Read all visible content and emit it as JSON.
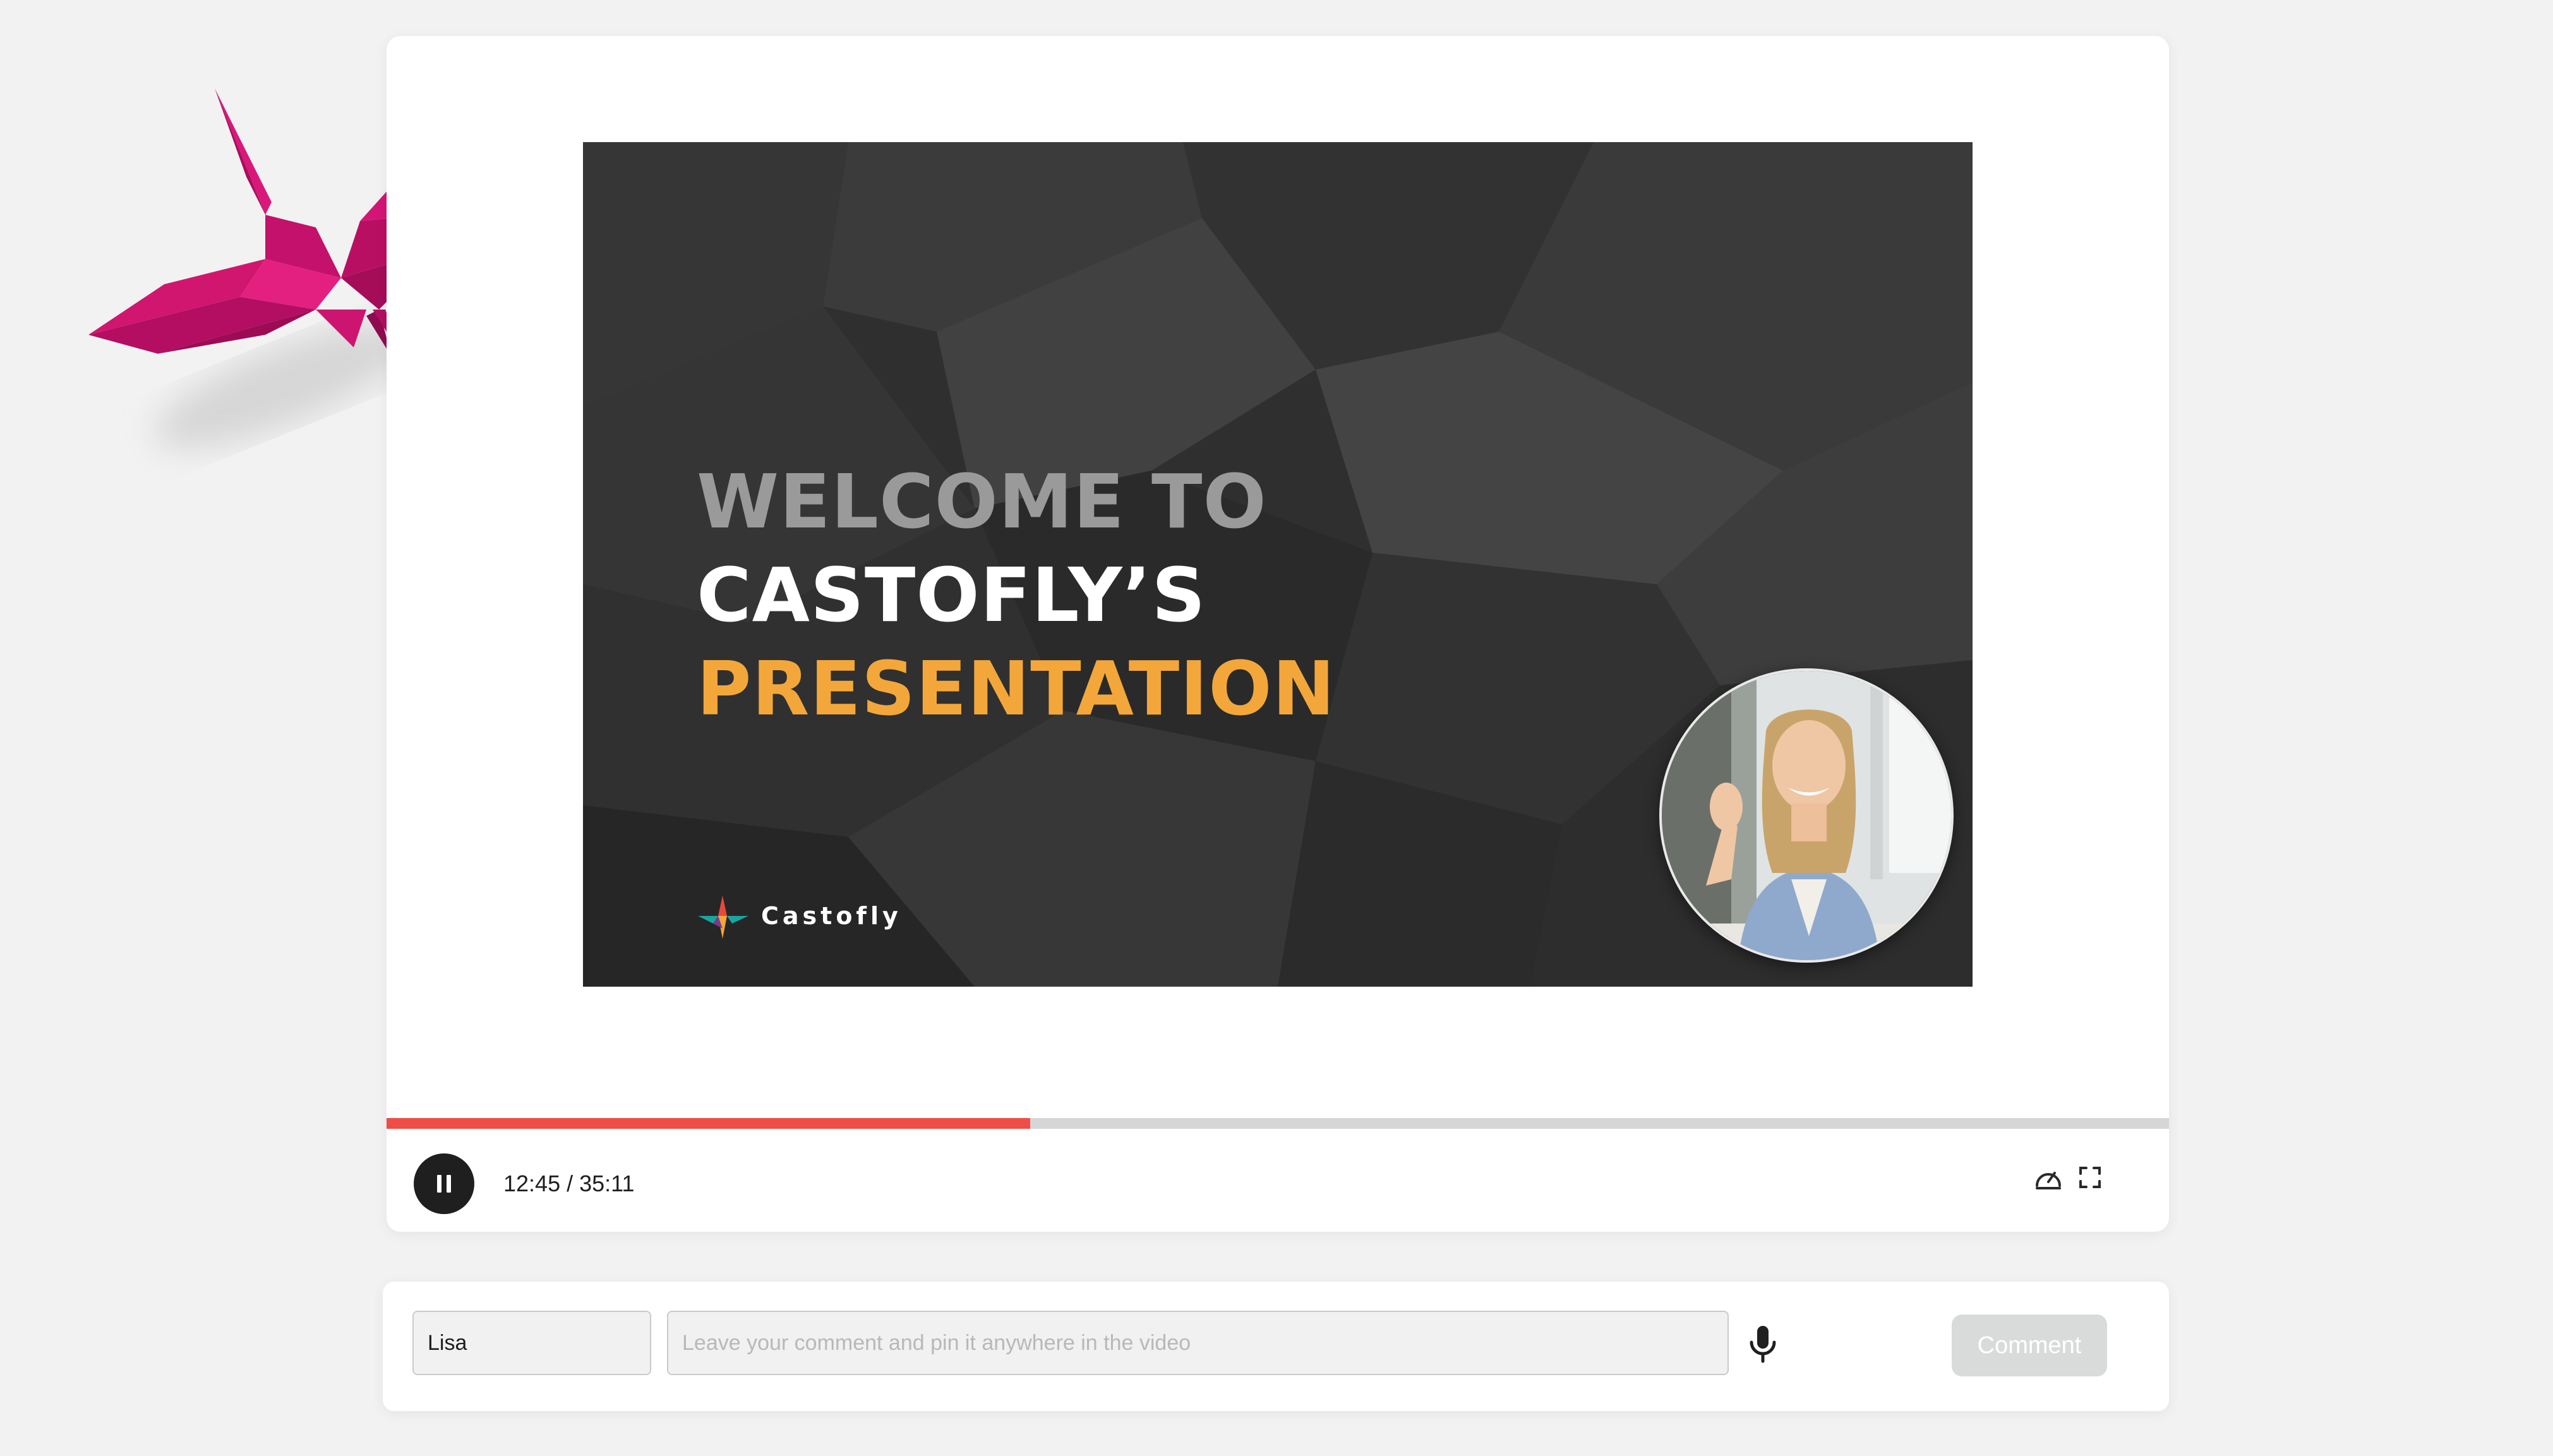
{
  "slide": {
    "title_line1": "WELCOME TO",
    "title_line2": "CASTOFLY’S",
    "title_line3": "PRESENTATION",
    "brand_name": "Castofly"
  },
  "player": {
    "progress_fraction": 0.361,
    "current_time": "12:45",
    "separator": " / ",
    "total_time": "35:11",
    "play_state": "pause-icon",
    "right_icons": [
      "speed-icon",
      "fullscreen-icon"
    ]
  },
  "comment": {
    "name_value": "Lisa",
    "comment_placeholder": "Leave your comment and pin it anywhere in the video",
    "comment_button": "Comment"
  },
  "colors": {
    "progress": "#ef4d48",
    "title_gray": "#9a9a9a",
    "title_orange": "#f3a73b",
    "crane": "#d0156f"
  }
}
